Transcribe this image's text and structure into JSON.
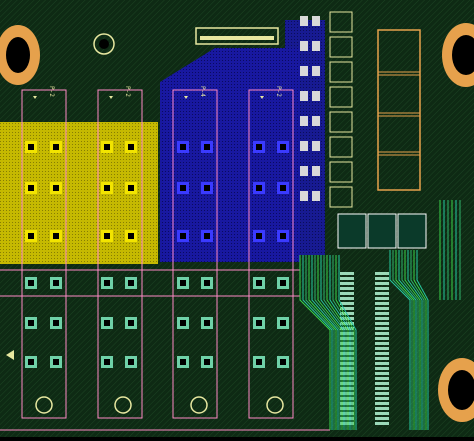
{
  "view": {
    "kind": "pcb-layout-editor-canvas",
    "layers_visible": [
      "top-copper-green",
      "copper-pour-yellow",
      "copper-pour-blue",
      "bottom-copper-dark-green",
      "silkscreen",
      "outline-pink"
    ]
  },
  "colors": {
    "board": "#0e2a14",
    "board_alt": "#143a1c",
    "pour_yellow": "#e3d200",
    "pour_blue": "#1b1bb5",
    "outline_pink": "#ff89c6",
    "silk": "#e7e7a0",
    "trace_green": "#3ad34a",
    "trace_teal": "#26c9a0",
    "orange": "#e6a14c",
    "via_white": "#f2f2f2"
  },
  "components": {
    "connector_top_label": "",
    "relay_labels": [
      "P-2",
      "P-2",
      "P-4",
      "P-2"
    ]
  }
}
